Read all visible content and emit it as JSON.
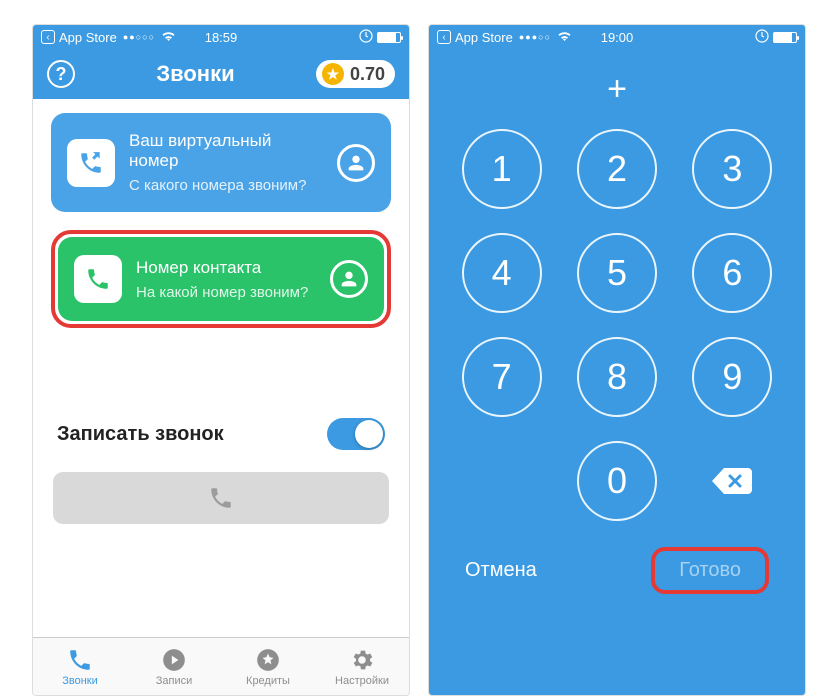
{
  "left": {
    "status": {
      "back": "App Store",
      "time": "18:59"
    },
    "header": {
      "title": "Звонки",
      "credit": "0.70"
    },
    "card_blue": {
      "title": "Ваш виртуальный номер",
      "sub": "С какого номера звоним?"
    },
    "card_green": {
      "title": "Номер контакта",
      "sub": "На какой номер звоним?"
    },
    "record_label": "Записать звонок",
    "tabs": {
      "calls": "Звонки",
      "records": "Записи",
      "credits": "Кредиты",
      "settings": "Настройки"
    }
  },
  "right": {
    "status": {
      "back": "App Store",
      "time": "19:00"
    },
    "display": "+",
    "keys": [
      "1",
      "2",
      "3",
      "4",
      "5",
      "6",
      "7",
      "8",
      "9",
      "",
      "0",
      ""
    ],
    "cancel": "Отмена",
    "done": "Готово"
  }
}
